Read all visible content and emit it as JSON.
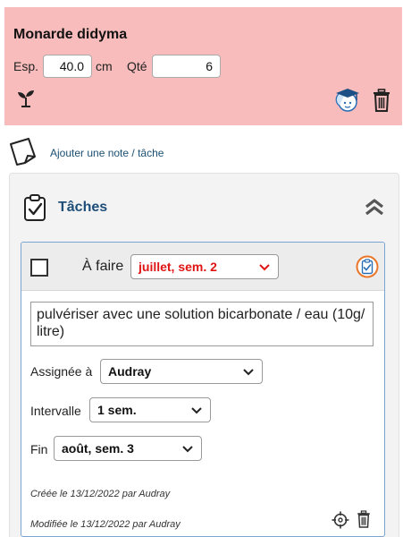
{
  "plant": {
    "name": "Monarde didyma",
    "spacing_label": "Esp.",
    "spacing_value": "40.0",
    "spacing_unit": "cm",
    "quantity_label": "Qté",
    "quantity_value": "6"
  },
  "icons": {
    "seedling": "seedling-icon",
    "expert": "expert-avatar-icon",
    "delete_plant": "trash-icon",
    "note": "note-icon",
    "tasks": "clipboard-check-icon",
    "collapse": "double-chevron-up-icon",
    "task_done": "clipboard-check-icon",
    "target": "crosshair-icon",
    "delete_task": "trash-icon"
  },
  "add_note": {
    "label": "Ajouter une note / tâche"
  },
  "tasks": {
    "title": "Tâches",
    "items": [
      {
        "status_label": "À faire",
        "due": "juillet, sem. 2",
        "description": "pulvériser avec une solution bicarbonate / eau (10g/ litre)",
        "assigned_label": "Assignée à",
        "assigned_value": "Audray",
        "interval_label": "Intervalle",
        "interval_value": "1 sem.",
        "end_label": "Fin",
        "end_value": "août, sem. 3",
        "created": "Créée le 13/12/2022 par Audray",
        "modified": "Modifiée le 13/12/2022 par Audray"
      }
    ]
  },
  "colors": {
    "plant_card_bg": "#f8bcbc",
    "title_blue": "#1e4e79",
    "due_red": "#e01414",
    "highlight_orange": "#e9762b",
    "card_border": "#7ba4d0"
  }
}
